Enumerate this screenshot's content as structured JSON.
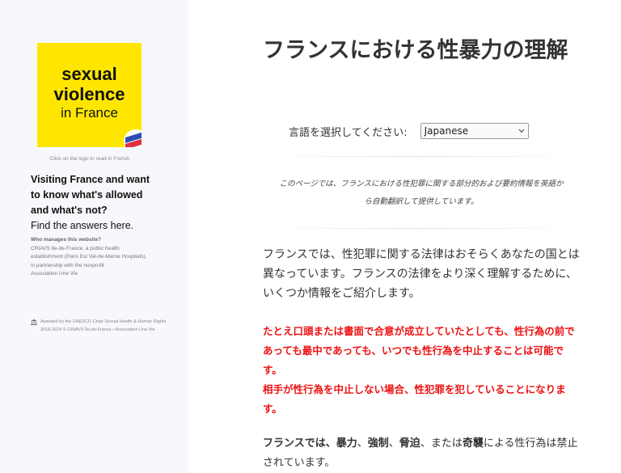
{
  "sidebar": {
    "logo": {
      "line1": "sexual",
      "line2": "violence",
      "line3": "in France"
    },
    "logo_caption": "Click on the logo to read in French",
    "tagline_bold_1": "Visiting France and want",
    "tagline_bold_2": "to know what's allowed",
    "tagline_bold_3": "and what's not?",
    "tagline_normal": "Find the answers here.",
    "manager_title": "Who manages this website?",
    "manager_lines": [
      "CRIAVS Ile-de-France, a public health",
      "establishment (Paris Est Val-de-Marne Hospitals),",
      "in partnership with the nonprofit",
      "Association Une Vie"
    ],
    "award_text": "Awarded by the UNESCO Chair Sexual Health & Human Rights",
    "copyright": "2018-2024 © CRIAVS Île-de-France • Association Une Vie"
  },
  "main": {
    "title": "フランスにおける性暴力の理解",
    "language_label": "言語を選択してください:",
    "language_selected": "Japanese",
    "notice_line1": "このページでは、フランスにおける性犯罪に関する部分的および要約情報を英語か",
    "notice_line2": "ら自動翻訳して提供しています。",
    "intro": "フランスでは、性犯罪に関する法律はおそらくあなたの国とは異なっています。フランスの法律をより深く理解するために、いくつか情報をご紹介します。",
    "warning_1": "たとえ口頭または書面で合意が成立していたとしても、性行為の前であっても最中であっても、いつでも性行為を中止することは可能です。",
    "warning_2": "相手が性行為を中止しない場合、性犯罪を犯していることになります。",
    "last_para": {
      "part1": "フランスでは、",
      "part2": "暴力",
      "part3": "、",
      "part4": "強制",
      "part5": "、",
      "part6": "脅迫",
      "part7": "、または",
      "part8": "奇襲",
      "part9": "による性行為は禁止されています。"
    }
  },
  "colors": {
    "logo_bg": "#ffe600",
    "warning": "#ee1111",
    "sidebar_bg": "#f6f8fb"
  }
}
